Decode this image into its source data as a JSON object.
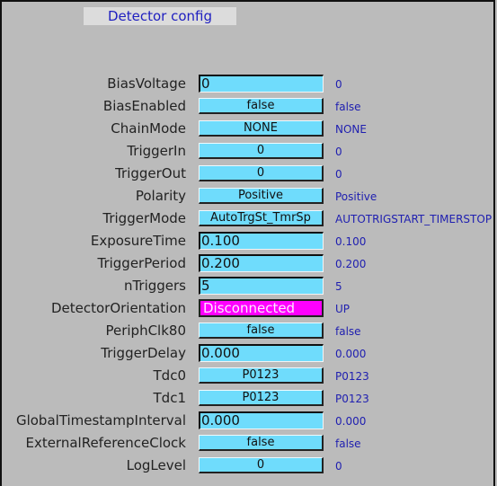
{
  "window": {
    "title": "Detector config"
  },
  "colors": {
    "control_bg": "#6fdcfc",
    "alarm_bg": "#ff00ff",
    "readback_text": "#2020b0",
    "panel_bg": "#bbbbbb",
    "title_bg": "#dcdcdc"
  },
  "rows": [
    {
      "label": "BiasVoltage",
      "type": "entry",
      "value": "0",
      "readback": "0"
    },
    {
      "label": "BiasEnabled",
      "type": "menu",
      "value": "false",
      "readback": "false"
    },
    {
      "label": "ChainMode",
      "type": "menu",
      "value": "NONE",
      "readback": "NONE"
    },
    {
      "label": "TriggerIn",
      "type": "menu",
      "value": "0",
      "readback": "0"
    },
    {
      "label": "TriggerOut",
      "type": "menu",
      "value": "0",
      "readback": "0"
    },
    {
      "label": "Polarity",
      "type": "menu",
      "value": "Positive",
      "readback": "Positive"
    },
    {
      "label": "TriggerMode",
      "type": "menu",
      "value": "AutoTrgSt_TmrSp",
      "readback": "AUTOTRIGSTART_TIMERSTOP"
    },
    {
      "label": "ExposureTime",
      "type": "entry",
      "value": "0.100",
      "readback": "0.100"
    },
    {
      "label": "TriggerPeriod",
      "type": "entry",
      "value": "0.200",
      "readback": "0.200"
    },
    {
      "label": "nTriggers",
      "type": "entry",
      "value": "5",
      "readback": "5"
    },
    {
      "label": "DetectorOrientation",
      "type": "alarm",
      "value": "Disconnected",
      "readback": "UP"
    },
    {
      "label": "PeriphClk80",
      "type": "menu",
      "value": "false",
      "readback": "false"
    },
    {
      "label": "TriggerDelay",
      "type": "entry",
      "value": "0.000",
      "readback": "0.000"
    },
    {
      "label": "Tdc0",
      "type": "menu",
      "value": "P0123",
      "readback": "P0123"
    },
    {
      "label": "Tdc1",
      "type": "menu",
      "value": "P0123",
      "readback": "P0123"
    },
    {
      "label": "GlobalTimestampInterval",
      "type": "entry",
      "value": "0.000",
      "readback": "0.000"
    },
    {
      "label": "ExternalReferenceClock",
      "type": "menu",
      "value": "false",
      "readback": "false"
    },
    {
      "label": "LogLevel",
      "type": "menu",
      "value": "0",
      "readback": "0"
    }
  ]
}
